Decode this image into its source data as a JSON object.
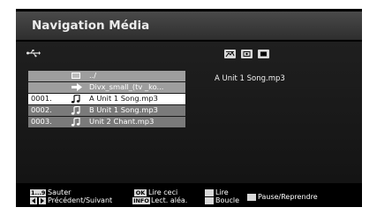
{
  "header": {
    "title": "Navigation Média"
  },
  "icons": {
    "usb": "usb-icon",
    "modes": [
      "photo-mode-icon",
      "music-mode-icon",
      "video-mode-icon"
    ]
  },
  "file_list": {
    "parent": "../",
    "folder": "Divx_small_(tv _ko...",
    "files": [
      {
        "num": "0001.",
        "name": "A Unit 1 Song.mp3",
        "selected": true
      },
      {
        "num": "0002.",
        "name": "B  Unit 1 Song.mp3",
        "selected": false
      },
      {
        "num": "0003.",
        "name": "Unit 2 Chant.mp3",
        "selected": false
      }
    ]
  },
  "now_playing": "A Unit 1 Song.mp3",
  "footer": {
    "jump_key": "1...9",
    "jump_label": "Sauter",
    "nav_label": "Précédent/Suivant",
    "ok_key": "OK",
    "ok_label": "Lire ceci",
    "info_key": "INFO",
    "info_label": "Lect. aléa.",
    "play_label": "Lire",
    "loop_label": "Boucle",
    "pause_label": "Pause/Reprendre"
  }
}
